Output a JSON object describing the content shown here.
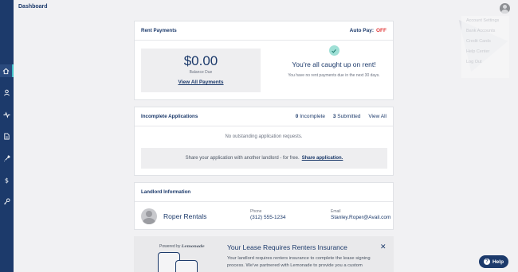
{
  "header": {
    "title": "Dashboard"
  },
  "user_menu": {
    "items": [
      "Account Settings",
      "Bank Accounts",
      "Credit Cards",
      "Help Center",
      "Log Out"
    ]
  },
  "sidebar": {
    "items": [
      "home-icon",
      "user-icon",
      "activity-icon",
      "document-icon",
      "wrench-icon",
      "dollar-icon",
      "key-icon"
    ]
  },
  "rent_payments": {
    "title": "Rent Payments",
    "autopay_label": "Auto Pay:",
    "autopay_value": "OFF",
    "balance": "$0.00",
    "balance_label": "Balance Due",
    "view_all": "View All Payments",
    "status_title": "You're all caught up on rent!",
    "status_detail": "You have no rent payments due in the next 30 days."
  },
  "applications": {
    "title": "Incomplete Applications",
    "incomplete_count": "0",
    "incomplete_label": "Incomplete",
    "submitted_count": "3",
    "submitted_label": "Submitted",
    "view_all": "View All",
    "empty": "No outstanding application requests.",
    "share_text": "Share your application with another landlord - for free.",
    "share_link": "Share application."
  },
  "landlord": {
    "title": "Landlord Information",
    "name": "Roper Rentals",
    "phone_label": "Phone",
    "phone": "(312) 555-1234",
    "email_label": "Email",
    "email": "Stanley.Roper@Avail.com"
  },
  "insurance": {
    "powered_by": "Powered by",
    "brand": "Lemonade",
    "title": "Your Lease Requires Renters Insurance",
    "body": "Your landlord requires renters insurance to complete the lease signing process. We've partnered with Lemonade to provide you a custom"
  },
  "help": {
    "label": "Help"
  },
  "colors": {
    "accent": "#1c3a6b",
    "off": "#e23b3b",
    "teal": "#3fc1c9",
    "check": "#9fe0d6"
  }
}
